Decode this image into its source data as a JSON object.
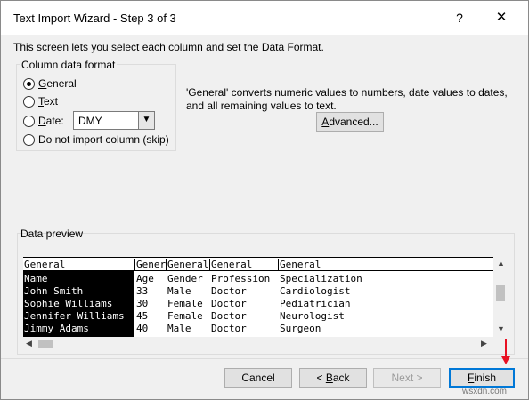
{
  "window": {
    "title": "Text Import Wizard - Step 3 of 3",
    "help_label": "?",
    "close_label": "✕"
  },
  "intro": "This screen lets you select each column and set the Data Format.",
  "column_format": {
    "legend": "Column data format",
    "options": [
      {
        "label_first": "G",
        "label_rest": "eneral",
        "selected": true
      },
      {
        "label_first": "T",
        "label_rest": "ext",
        "selected": false
      },
      {
        "label_first": "D",
        "label_rest": "ate:",
        "selected": false
      },
      {
        "label_full": "Do not import column (skip)",
        "selected": false
      }
    ],
    "date_format": "DMY"
  },
  "description": "'General' converts numeric values to numbers, date values to dates, and all remaining values to text.",
  "advanced_label_first": "A",
  "advanced_label_rest": "dvanced...",
  "preview": {
    "label": "Data preview",
    "headers": [
      "General",
      "Gener",
      "General",
      "General",
      "General"
    ],
    "rows": [
      [
        "Name",
        "Age",
        "Gender",
        "Profession",
        "Specialization"
      ],
      [
        "John Smith",
        "33",
        "Male",
        "Doctor",
        "Cardiologist"
      ],
      [
        "Sophie Williams",
        "30",
        "Female",
        "Doctor",
        "Pediatrician"
      ],
      [
        "Jennifer Williams",
        "45",
        "Female",
        "Doctor",
        "Neurologist"
      ],
      [
        "Jimmy Adams",
        "40",
        "Male",
        "Doctor",
        "Surgeon"
      ]
    ]
  },
  "buttons": {
    "cancel": "Cancel",
    "back_prefix": "< ",
    "back_first": "B",
    "back_rest": "ack",
    "next": "Next >",
    "finish_first": "F",
    "finish_rest": "inish"
  },
  "colors": {
    "accent": "#0078d7",
    "annotation_arrow": "#e81123"
  },
  "watermark": "wsxdn.com"
}
